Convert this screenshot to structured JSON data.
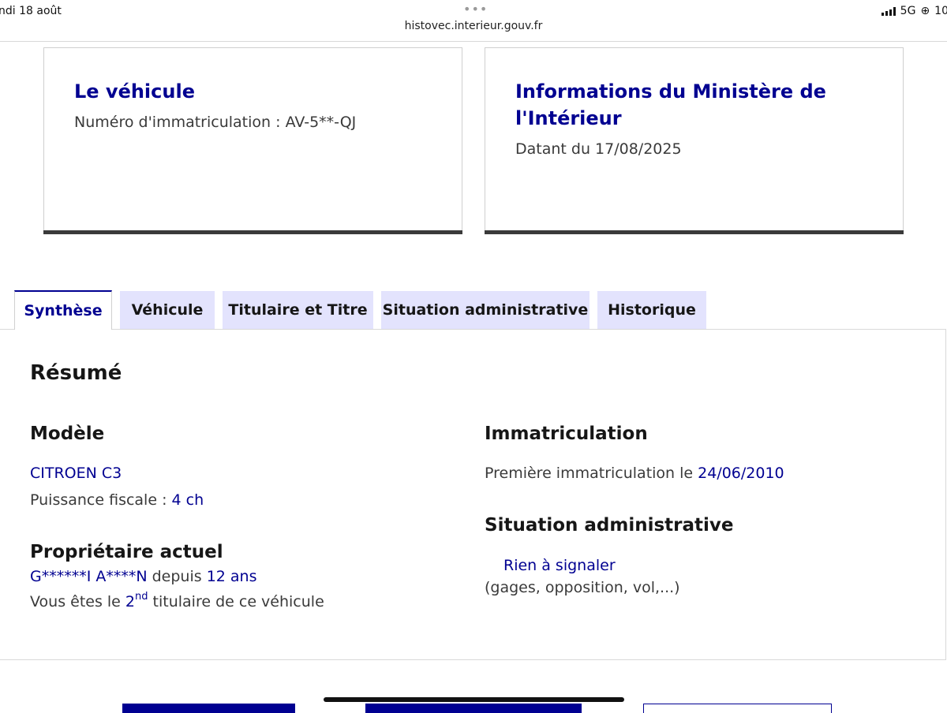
{
  "status_bar": {
    "date": "ndi 18 août",
    "url": "histovec.interieur.gouv.fr",
    "network": "5G",
    "battery_partial": "10"
  },
  "vehicle_card": {
    "title": "Le véhicule",
    "plate_label": "Numéro d'immatriculation : ",
    "plate_value": "AV-5**-QJ"
  },
  "ministry_card": {
    "title": "Informations du Ministère de l'Intérieur",
    "date_label": "Datant du ",
    "date_value": "17/08/2025"
  },
  "tabs": [
    {
      "label": "Synthèse",
      "active": true
    },
    {
      "label": "Véhicule",
      "active": false
    },
    {
      "label": "Titulaire et Titre",
      "active": false
    },
    {
      "label": "Situation administrative",
      "active": false
    },
    {
      "label": "Historique",
      "active": false
    }
  ],
  "summary": {
    "heading": "Résumé",
    "model": {
      "heading": "Modèle",
      "name": "CITROEN C3",
      "power_label": "Puissance fiscale : ",
      "power_value": "4 ch"
    },
    "owner": {
      "heading": "Propriétaire actuel",
      "name": "G******I A****N",
      "since_label": " depuis ",
      "since_value": "12 ans",
      "rank_prefix": "Vous êtes le ",
      "rank_value": "2",
      "rank_sup": "nd",
      "rank_suffix": " titulaire de ce véhicule"
    },
    "registration": {
      "heading": "Immatriculation",
      "first_label": "Première immatriculation le ",
      "first_date": "24/06/2010"
    },
    "admin": {
      "heading": "Situation administrative",
      "status": "Rien à signaler",
      "details": "(gages, opposition, vol,...)"
    }
  },
  "colors": {
    "primary": "#000091",
    "tab_background": "#e3e3fd",
    "text": "#3a3a3a"
  }
}
